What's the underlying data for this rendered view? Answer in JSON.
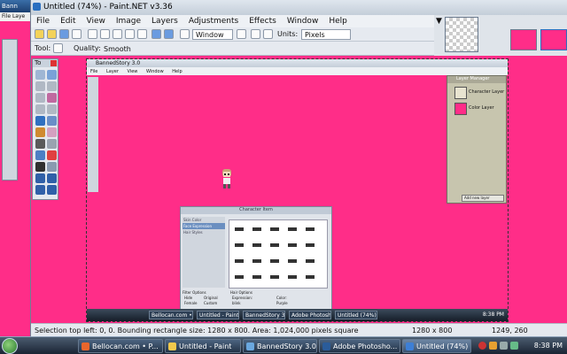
{
  "bg_window": {
    "title": "Bann",
    "menu": "File  Laye"
  },
  "paintnet": {
    "title": "Untitled (74%) - Paint.NET v3.36",
    "menu": [
      "File",
      "Edit",
      "View",
      "Image",
      "Layers",
      "Adjustments",
      "Effects",
      "Window",
      "Help"
    ],
    "toolbar": {
      "window_dropdown": "Window",
      "units_label": "Units:",
      "units_value": "Pixels"
    },
    "toolbar2": {
      "tool_label": "Tool:",
      "quality_label": "Quality:",
      "quality_value": "Smooth"
    },
    "tools_panel_title": "To",
    "status": {
      "selection_text": "Selection top left: 0, 0. Bounding rectangle size: 1280 x 800. Area: 1,024,000 pixels square",
      "image_size": "1280 x 800",
      "cursor_pos": "1249, 260"
    }
  },
  "canvas_content": {
    "app_title": "BannedStory 3.0",
    "menu": [
      "File",
      "Layer",
      "View",
      "Window",
      "Help"
    ],
    "layer_window_title": "Layer Manager",
    "layers": [
      "Character Layer",
      "Color Layer"
    ],
    "layer_button": "Add new layer",
    "char_window_title": "Character Item",
    "char_categories": [
      "Skin Color",
      "Face Expression",
      "Hair Styles"
    ],
    "filter_options_label": "Filter Options",
    "filter_options": [
      "Hide",
      "Original",
      "Female",
      "Custom"
    ],
    "hair_options_label": "Hair Options",
    "expression_label": "Expression:",
    "expression_value": "blink",
    "color_label": "Color:",
    "color_value": "Purple",
    "taskbar": [
      "Bellocan.com • P...",
      "Untitled - Paint",
      "BannedStory 3.0",
      "Adobe Photosho...",
      "Untitled (74%) ..."
    ],
    "clock": "8:38 PM"
  },
  "taskbar": {
    "items": [
      {
        "label": "Bellocan.com • P...",
        "color": "#e8662c"
      },
      {
        "label": "Untitled - Paint",
        "color": "#f2c94c"
      },
      {
        "label": "BannedStory 3.0",
        "color": "#6aa8e0"
      },
      {
        "label": "Adobe Photosho...",
        "color": "#2a5c9a"
      },
      {
        "label": "Untitled (74%) - P...",
        "color": "#3d7fd6"
      }
    ],
    "clock": "8:38 PM"
  },
  "colors": {
    "canvas_pink": "#ff2d88",
    "accent_blue": "#3a6ea8"
  }
}
